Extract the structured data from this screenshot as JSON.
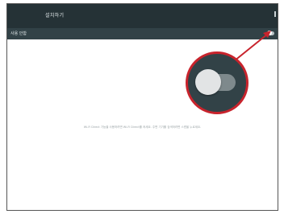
{
  "status_bar": {
    "title": "설치하기"
  },
  "toolbar": {
    "title": "사용 안함",
    "toggle_state": "off"
  },
  "content": {
    "empty_message": "Wi-Fi Direct 기능을 사용하려면 Wi-Fi Direct를 켜세요. 주변 기기를 검색하려면 스캔을 누르세요."
  },
  "callout": {
    "toggle_state": "off"
  },
  "colors": {
    "status_bar": "#253236",
    "toolbar": "#324247",
    "callout_border": "#c8232c",
    "arrow": "#c8232c"
  }
}
